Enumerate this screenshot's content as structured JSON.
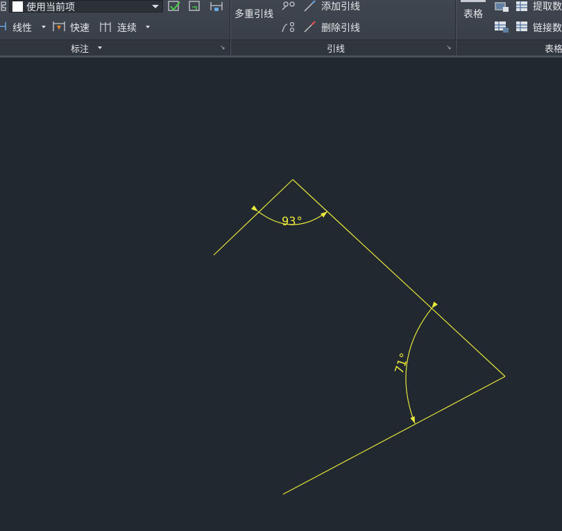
{
  "ribbon": {
    "style_combo": {
      "value": "使用当前项"
    },
    "dimension_panel": {
      "title": "标注",
      "linear_label": "线性",
      "quick_label": "快速",
      "continue_label": "连续"
    },
    "leader_panel": {
      "title": "引线",
      "multileader_label": "多重引线",
      "add_leader_label": "添加引线",
      "remove_leader_label": "删除引线"
    },
    "table_panel": {
      "title": "表格",
      "table_label": "表格",
      "extract_data_label": "提取数",
      "link_data_label": "链接数"
    }
  },
  "drawing": {
    "background": "#212830",
    "line_color": "#e8e83a",
    "dimensions": [
      {
        "label": "93°",
        "angle_deg": 93
      },
      {
        "label": "71°",
        "angle_deg": 71
      }
    ]
  }
}
